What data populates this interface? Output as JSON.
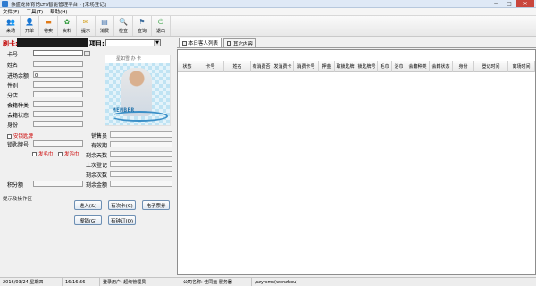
{
  "window": {
    "title": "佛盛龙体育馆LTS智能管理平台 - [来场登记]",
    "controls": [
      "─",
      "□",
      "✕"
    ]
  },
  "menu": [
    "文件(F)",
    "工具(T)",
    "帮助(H)"
  ],
  "toolbar": [
    {
      "label": "来场",
      "icon": "person-arrive-icon",
      "glyph": "👥",
      "color": "#2a66b5"
    },
    {
      "label": "开单",
      "icon": "open-order-icon",
      "glyph": "👤",
      "color": "#3a7cc4"
    },
    {
      "label": "特卖",
      "icon": "special-sale-icon",
      "glyph": "▬",
      "color": "#e07a16"
    },
    {
      "label": "资料",
      "icon": "data-icon",
      "glyph": "✿",
      "color": "#2f9a3a"
    },
    {
      "label": "提示",
      "icon": "hint-icon",
      "glyph": "✉",
      "color": "#d6a52a"
    },
    {
      "label": "消费",
      "icon": "consume-icon",
      "glyph": "▤",
      "color": "#4a78b0"
    },
    {
      "label": "检查",
      "icon": "check-icon",
      "glyph": "🔍",
      "color": "#2b6bb3"
    },
    {
      "label": "查询",
      "icon": "query-icon",
      "glyph": "⚑",
      "color": "#3c6c9c"
    },
    {
      "label": "退出",
      "icon": "exit-icon",
      "glyph": "⏻",
      "color": "#2e9d3a"
    }
  ],
  "left": {
    "swipe_label": "刷卡:",
    "project_label": "项目:",
    "fields": [
      "卡号",
      "姓名",
      "进场余额",
      "性别",
      "分店",
      "会籍种类",
      "会籍状态",
      "身份"
    ],
    "balance_value": "0",
    "photo_title": "星如雪  办 卡",
    "photo_brand": "MEMBER",
    "chk_lock": "安锁匙牌",
    "locker_label": "锁匙牌号",
    "chk_towel": "发毛巾",
    "chk_bath": "发浴巾",
    "right_fields": [
      "销售员",
      "有效期",
      "剩余天数",
      "上次登记",
      "剩余次数",
      "剩余金额"
    ],
    "points_label": "积分额",
    "hint_label": "提示及操作区",
    "buttons": {
      "enter": "进入(&)",
      "change_card": "有次卡(C)",
      "e_ticket": "电子票券",
      "move": "报销(G)",
      "order": "有钟订(Q)"
    }
  },
  "right": {
    "tabs": [
      "本日客人列表",
      "其它内容"
    ],
    "columns": [
      "状态",
      "卡号",
      "姓名",
      "有消费否",
      "发消费卡",
      "消费卡号",
      "押金",
      "取锁匙牌",
      "锁匙牌号",
      "毛巾",
      "浴巾",
      "会籍种类",
      "会籍状态",
      "身份",
      "登记时间",
      "离场时间"
    ]
  },
  "status": {
    "date": "2016/03/24  星期四",
    "time": "16:16:56",
    "user": "登录用户: 超级管理员",
    "company": "公司名称: 佳同运  服务器",
    "server": "\\szyrsms(wenzhou)"
  }
}
